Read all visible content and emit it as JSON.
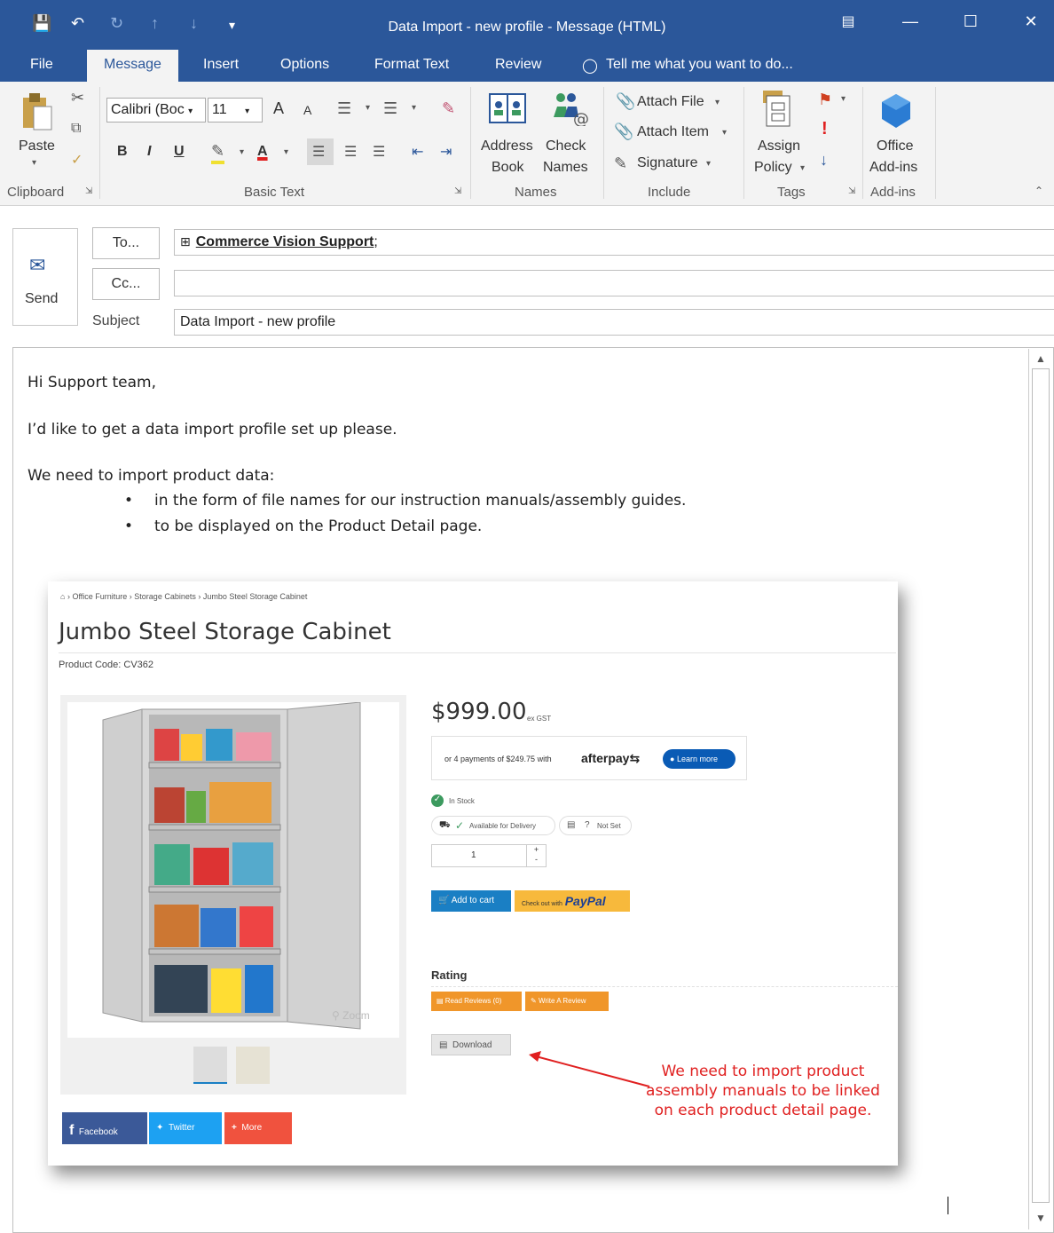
{
  "window": {
    "title": "Data Import - new profile - Message (HTML)"
  },
  "tabs": [
    "File",
    "Message",
    "Insert",
    "Options",
    "Format Text",
    "Review"
  ],
  "tell_me": "Tell me what you want to do...",
  "ribbon": {
    "clipboard": {
      "paste": "Paste",
      "label": "Clipboard"
    },
    "basic_text": {
      "font": "Calibri (Boc",
      "size": "11",
      "bold": "B",
      "italic": "I",
      "underline": "U",
      "grow": "A",
      "label": "Basic Text"
    },
    "names": {
      "address_book_1": "Address",
      "address_book_2": "Book",
      "check_names_1": "Check",
      "check_names_2": "Names",
      "label": "Names"
    },
    "include": {
      "attach_file": "Attach File",
      "attach_item": "Attach Item",
      "signature": "Signature",
      "label": "Include"
    },
    "tags": {
      "assign_policy_1": "Assign",
      "assign_policy_2": "Policy",
      "label": "Tags"
    },
    "addins": {
      "office_addins_1": "Office",
      "office_addins_2": "Add-ins",
      "label": "Add-ins"
    }
  },
  "header": {
    "send": "Send",
    "to_button": "To...",
    "cc_button": "Cc...",
    "subject_label": "Subject",
    "to_value": "Commerce Vision Support",
    "to_suffix": ";",
    "cc_value": "",
    "subject_value": "Data Import - new profile"
  },
  "body": {
    "greeting": "Hi Support team,",
    "line1": "I’d like to get a data import profile set up please.",
    "line2": "We need to import product data:",
    "bullets": [
      "in the form of file names for our instruction manuals/assembly guides.",
      "to be displayed on the Product Detail page."
    ]
  },
  "product_page": {
    "breadcrumb": [
      "Office Furniture",
      "Storage Cabinets",
      "Jumbo Steel Storage Cabinet"
    ],
    "title": "Jumbo Steel Storage Cabinet",
    "product_code": "Product Code: CV362",
    "price": "$999.00",
    "price_suffix": "ex GST",
    "afterpay_text": "or 4 payments of $249.75 with",
    "afterpay_brand": "afterpay",
    "learn_more": "Learn more",
    "in_stock": "In Stock",
    "delivery": "Available for Delivery",
    "not_set": "Not Set",
    "quantity": "1",
    "add_to_cart": "Add to cart",
    "checkout_with": "Check out with",
    "paypal": "PayPal",
    "rating": "Rating",
    "read_reviews": "Read Reviews (0)",
    "write_review": "Write A Review",
    "download": "Download",
    "zoom": "Zoom",
    "share": [
      "Facebook",
      "Twitter",
      "More"
    ],
    "annotation": "We need to import product assembly manuals to be linked on each product detail page."
  },
  "colors": {
    "title_bar": "#2b579a",
    "ribbon_bg": "#f3f3f3",
    "annotation_red": "#e02020",
    "afterpay_blue": "#0a5bb5",
    "cart_blue": "#1a7fc4",
    "paypal_yellow": "#f7b93c",
    "review_orange": "#f0962a",
    "facebook": "#3b5998",
    "twitter": "#1da1f2",
    "more": "#f0523e"
  }
}
